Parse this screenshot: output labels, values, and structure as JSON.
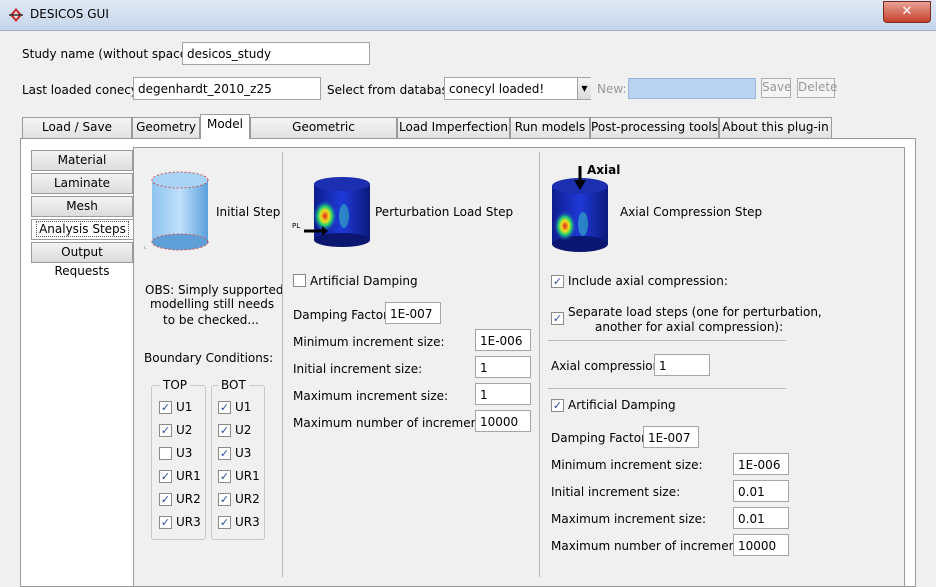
{
  "window": {
    "title": "DESICOS GUI",
    "close_label": "✕"
  },
  "study": {
    "label": "Study name (without spaces):",
    "value": "desicos_study"
  },
  "conecyl": {
    "label": "Last loaded conecyl:",
    "value": "degenhardt_2010_z25"
  },
  "database": {
    "label": "Select from database:",
    "value": "conecyl loaded!",
    "new_label": "New:",
    "new_value": "",
    "save_label": "Save",
    "delete_label": "Delete"
  },
  "tabs": [
    "Load / Save Study",
    "Geometry",
    "Model",
    "Geometric Imperfections",
    "Load Imperfection",
    "Run models",
    "Post-processing tools",
    "About this plug-in"
  ],
  "side_tabs": [
    "Material",
    "Laminate",
    "Mesh",
    "Analysis Steps",
    "Output Requests"
  ],
  "initial": {
    "title": "Initial Step",
    "obs": [
      "OBS: Simply supported",
      "modelling still needs",
      "to be checked..."
    ],
    "bc_label": "Boundary Conditions:",
    "top_label": "TOP",
    "bot_label": "BOT",
    "top": [
      {
        "label": "U1",
        "checked": true
      },
      {
        "label": "U2",
        "checked": true
      },
      {
        "label": "U3",
        "checked": false
      },
      {
        "label": "UR1",
        "checked": true
      },
      {
        "label": "UR2",
        "checked": true
      },
      {
        "label": "UR3",
        "checked": true
      }
    ],
    "bot": [
      {
        "label": "U1",
        "checked": true
      },
      {
        "label": "U2",
        "checked": true
      },
      {
        "label": "U3",
        "checked": true
      },
      {
        "label": "UR1",
        "checked": true
      },
      {
        "label": "UR2",
        "checked": true
      },
      {
        "label": "UR3",
        "checked": true
      }
    ]
  },
  "perturbation": {
    "title": "Perturbation Load Step",
    "pl_label": "PL",
    "damping_label": "Artificial Damping",
    "damping_checked": false,
    "factor_label": "Damping Factor:",
    "factor_value": "1E-007",
    "min_label": "Minimum increment size:",
    "min_value": "1E-006",
    "init_label": "Initial increment size:",
    "init_value": "1",
    "max_label": "Maximum increment size:",
    "max_value": "1",
    "maxnum_label": "Maximum number of increments:",
    "maxnum_value": "10000"
  },
  "axial": {
    "title": "Axial Compression Step",
    "axial_label": "Axial",
    "include_label": "Include axial compression:",
    "include_checked": true,
    "separate_label_1": "Separate load steps (one for perturbation,",
    "separate_label_2": "another for axial compression):",
    "separate_checked": true,
    "comp_label": "Axial compression:",
    "comp_value": "1",
    "damping_label": "Artificial Damping",
    "damping_checked": true,
    "factor_label": "Damping Factor:",
    "factor_value": "1E-007",
    "min_label": "Minimum increment size:",
    "min_value": "1E-006",
    "init_label": "Initial increment size:",
    "init_value": "0.01",
    "max_label": "Maximum increment size:",
    "max_value": "0.01",
    "maxnum_label": "Maximum number of increments:",
    "maxnum_value": "10000"
  },
  "colors": {
    "accent": "#b8d2ef",
    "tab_border": "#9a9a9a",
    "check": "#2a4a9a"
  }
}
